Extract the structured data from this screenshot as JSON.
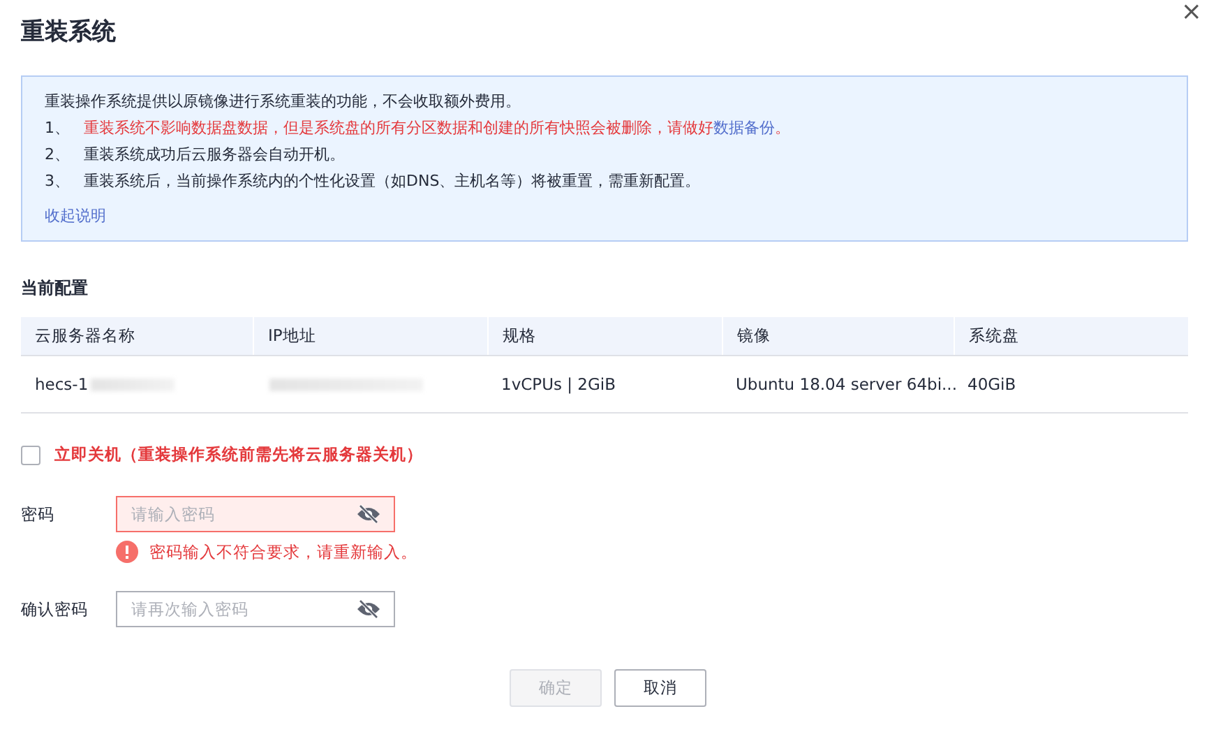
{
  "dialog": {
    "title": "重装系统",
    "close_icon": "×"
  },
  "notice": {
    "intro": "重装操作系统提供以原镜像进行系统重装的功能，不会收取额外费用。",
    "items": [
      {
        "number": "1、",
        "kind": "warning",
        "text": "重装系统不影响数据盘数据，但是系统盘的所有分区数据和创建的所有快照会被删除，请做好",
        "link": "数据备份",
        "after": "。"
      },
      {
        "number": "2、",
        "kind": "plain",
        "text": "重装系统成功后云服务器会自动开机。"
      },
      {
        "number": "3、",
        "kind": "plain",
        "text": "重装系统后，当前操作系统内的个性化设置（如DNS、主机名等）将被重置，需重新配置。"
      }
    ],
    "collapse_link": "收起说明"
  },
  "current_config": {
    "title": "当前配置",
    "columns": [
      "云服务器名称",
      "IP地址",
      "规格",
      "镜像",
      "系统盘"
    ],
    "rows": [
      {
        "cells": [
          {
            "text": "hecs-1",
            "redacted": true
          },
          {
            "redacted": true
          },
          {
            "text": "1vCPUs | 2GiB"
          },
          {
            "text": "Ubuntu 18.04 server 64bi..."
          },
          {
            "text": "40GiB"
          }
        ]
      }
    ]
  },
  "shutdown": {
    "checked": false,
    "label": "立即关机（重装操作系统前需先将云服务器关机）"
  },
  "fields": [
    {
      "label": "密码",
      "placeholder": "请输入密码",
      "error": "密码输入不符合要求，请重新输入。"
    },
    {
      "label": "确认密码",
      "placeholder": "请再次输入密码"
    }
  ],
  "buttons": [
    {
      "label": "确定",
      "disabled": true
    },
    {
      "label": "取消",
      "disabled": false
    }
  ]
}
